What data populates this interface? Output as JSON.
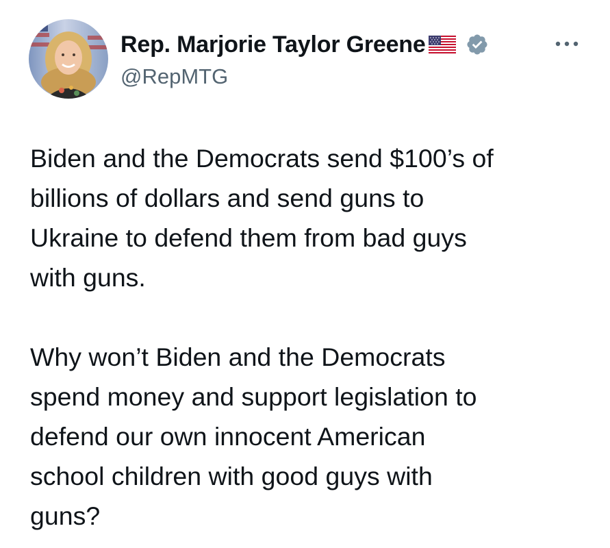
{
  "author": {
    "display_name": "Rep. Marjorie Taylor Greene",
    "handle": "@RepMTG",
    "flag_icon": "us-flag-icon",
    "verified_icon": "verified-badge-icon",
    "verified_color": "#829aab"
  },
  "menu": {
    "more_icon": "more-options-icon"
  },
  "tweet": {
    "paragraphs": [
      "Biden and the Democrats send $100’s of\nbillions of dollars and send guns to\nUkraine to defend them from bad guys\nwith guns.",
      "Why won’t Biden and the Democrats\nspend money and support legislation to\ndefend our own innocent American\nschool children with good guys with\nguns?"
    ]
  },
  "colors": {
    "text_primary": "#0f1419",
    "text_secondary": "#536471",
    "background": "#ffffff"
  }
}
